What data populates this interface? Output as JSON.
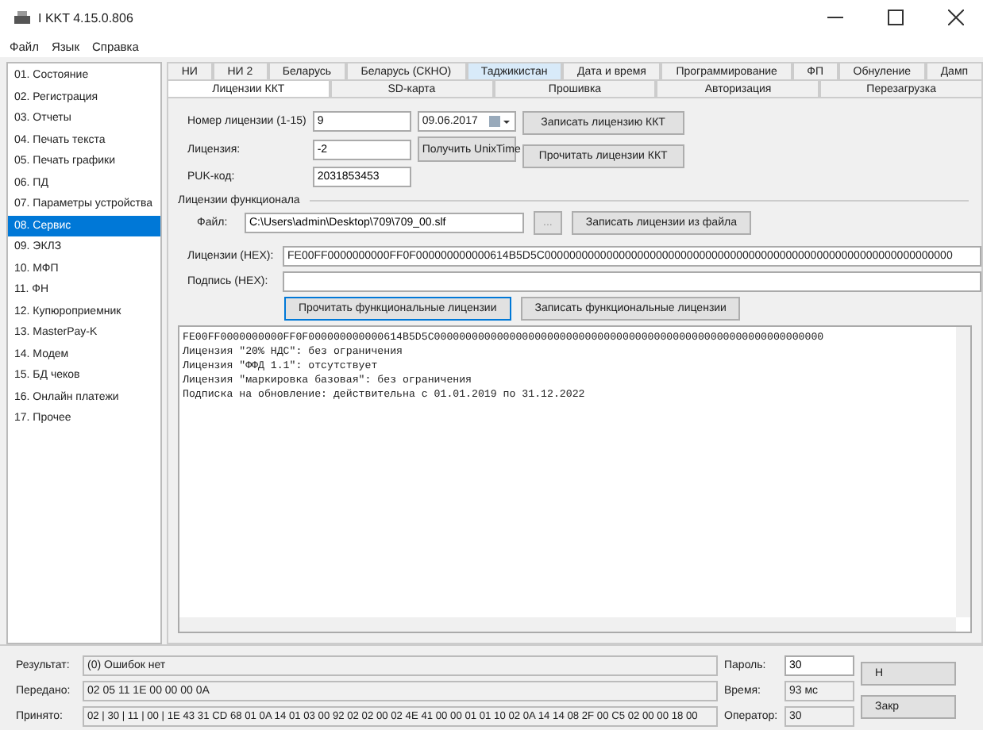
{
  "window": {
    "title": "I KKT 4.15.0.806"
  },
  "menu": [
    "Файл",
    "Язык",
    "Справка"
  ],
  "sidebar": {
    "items": [
      {
        "label": "01. Состояние",
        "selected": false
      },
      {
        "label": "02. Регистрация",
        "selected": false
      },
      {
        "label": "03. Отчеты",
        "selected": false
      },
      {
        "label": "04. Печать текста",
        "selected": false
      },
      {
        "label": "05. Печать графики",
        "selected": false
      },
      {
        "label": "06. ПД",
        "selected": false
      },
      {
        "label": "07. Параметры устройства",
        "selected": false
      },
      {
        "label": "08. Сервис",
        "selected": true
      },
      {
        "label": "09. ЭКЛЗ",
        "selected": false
      },
      {
        "label": "10. МФП",
        "selected": false
      },
      {
        "label": "11. ФН",
        "selected": false
      },
      {
        "label": "12. Купюроприемник",
        "selected": false
      },
      {
        "label": "13. MasterPay-K",
        "selected": false
      },
      {
        "label": "14. Модем",
        "selected": false
      },
      {
        "label": "15. БД чеков",
        "selected": false
      },
      {
        "label": "16. Онлайн платежи",
        "selected": false
      },
      {
        "label": "17. Прочее",
        "selected": false
      }
    ]
  },
  "tabs_top": [
    {
      "label": "НИ",
      "selected": false,
      "highlighted": false
    },
    {
      "label": "НИ 2",
      "selected": false,
      "highlighted": false
    },
    {
      "label": "Беларусь",
      "selected": false,
      "highlighted": false
    },
    {
      "label": "Беларусь (СКНО)",
      "selected": false,
      "highlighted": false
    },
    {
      "label": "Таджикистан",
      "selected": false,
      "highlighted": true
    },
    {
      "label": "Дата и время",
      "selected": false,
      "highlighted": false
    },
    {
      "label": "Программирование",
      "selected": false,
      "highlighted": false
    },
    {
      "label": "ФП",
      "selected": false,
      "highlighted": false
    },
    {
      "label": "Обнуление",
      "selected": false,
      "highlighted": false
    },
    {
      "label": "Дамп",
      "selected": false,
      "highlighted": false
    }
  ],
  "tabs": [
    {
      "label": "Лицензии ККТ",
      "selected": true
    },
    {
      "label": "SD-карта",
      "selected": false
    },
    {
      "label": "Прошивка",
      "selected": false
    },
    {
      "label": "Авторизация",
      "selected": false
    },
    {
      "label": "Перезагрузка",
      "selected": false
    }
  ],
  "license": {
    "number_label": "Номер лицензии (1-15)",
    "number": "9",
    "date": "09.06.2017",
    "license_label": "Лицензия:",
    "license": "-2",
    "unixtime_button": "Получить UnixTime",
    "puk_label": "PUK-код:",
    "puk": "2031853453",
    "write_button": "Записать лицензию ККТ",
    "read_button": "Прочитать лицензии ККТ"
  },
  "functional": {
    "title": "Лицензии функционала",
    "file_label": "Файл:",
    "file": "C:\\Users\\admin\\Desktop\\709\\709_00.slf",
    "browse_button": "...",
    "write_file_button": "Записать лицензии из файла",
    "hex_label": "Лицензии (HEX):",
    "hex": "FE00FF0000000000FF0F000000000000614B5D5C000000000000000000000000000000000000000000000000000000000000000000",
    "sign_label": "Подпись (HEX):",
    "read_button": "Прочитать функциональные лицензии",
    "write_button": "Записать функциональные лицензии"
  },
  "output": [
    "FE00FF0000000000FF0F000000000000614B5D5C00000000000000000000000000000000000000000000000000000000000000",
    "Лицензия \"20% НДС\": без ограничения",
    "Лицензия \"ФФД 1.1\": отсутствует",
    "Лицензия \"маркировка базовая\": без ограничения",
    "Подписка на обновление: действительна с 01.01.2019 по 31.12.2022"
  ],
  "status": {
    "result_label": "Результат:",
    "result": "(0) Ошибок нет",
    "sent_label": "Передано:",
    "sent": "02 05 11 1E 00 00 00 0A",
    "received_label": "Принято:",
    "received": "02 | 30 | 11 | 00 | 1E 43 31 CD 68 01 0A 14 01 03 00 92 02 02 00 02 4E 41 00 00 01 01 10 02 0A 14 14 08 2F 00 C5 02 00 00 18 00",
    "password_label": "Пароль:",
    "password": "30",
    "time_label": "Время:",
    "time": "93 мс",
    "operator_label": "Оператор:",
    "operator": "30",
    "buttons": [
      "Н",
      "Закр"
    ]
  }
}
